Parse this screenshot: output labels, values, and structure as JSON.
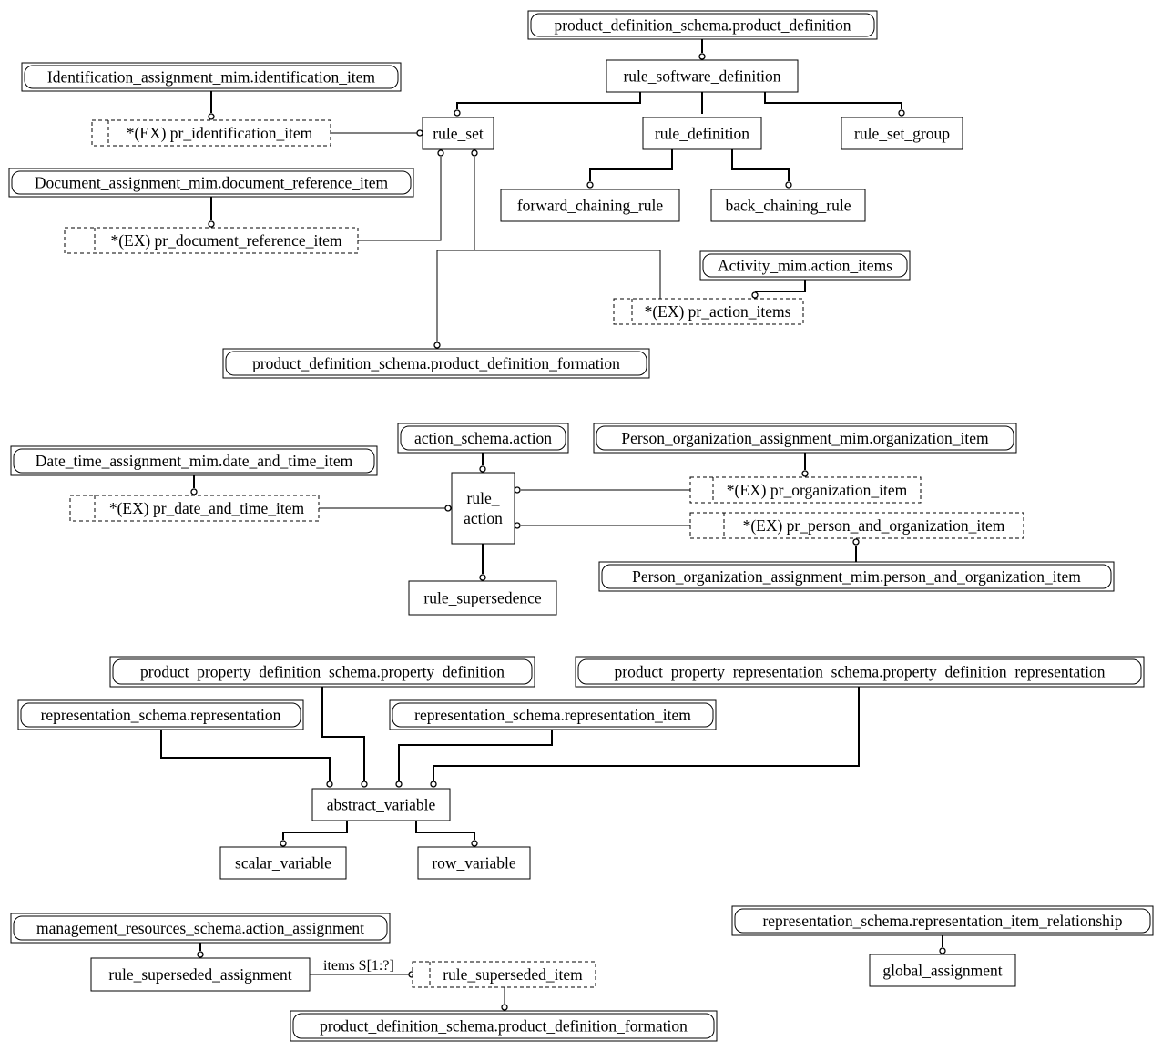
{
  "nodes": [
    {
      "id": "pds_pd",
      "kind": "ref",
      "label": "product_definition_schema.product_definition"
    },
    {
      "id": "rsd",
      "kind": "entity",
      "label": "rule_software_definition"
    },
    {
      "id": "ida",
      "kind": "ref",
      "label": "Identification_assignment_mim.identification_item"
    },
    {
      "id": "pr_id",
      "kind": "select",
      "label": "*(EX) pr_identification_item"
    },
    {
      "id": "rule_set",
      "kind": "entity",
      "label": "rule_set"
    },
    {
      "id": "rule_def",
      "kind": "entity",
      "label": "rule_definition"
    },
    {
      "id": "rsg",
      "kind": "entity",
      "label": "rule_set_group"
    },
    {
      "id": "dam",
      "kind": "ref",
      "label": "Document_assignment_mim.document_reference_item"
    },
    {
      "id": "pr_doc",
      "kind": "select",
      "label": "*(EX) pr_document_reference_item"
    },
    {
      "id": "fcr",
      "kind": "entity",
      "label": "forward_chaining_rule"
    },
    {
      "id": "bcr",
      "kind": "entity",
      "label": "back_chaining_rule"
    },
    {
      "id": "act_mim",
      "kind": "ref",
      "label": "Activity_mim.action_items"
    },
    {
      "id": "pr_action",
      "kind": "select",
      "label": "*(EX) pr_action_items"
    },
    {
      "id": "pdf",
      "kind": "ref",
      "label": "product_definition_schema.product_definition_formation"
    },
    {
      "id": "action",
      "kind": "ref",
      "label": "action_schema.action"
    },
    {
      "id": "poa_org",
      "kind": "ref",
      "label": "Person_organization_assignment_mim.organization_item"
    },
    {
      "id": "dta",
      "kind": "ref",
      "label": "Date_time_assignment_mim.date_and_time_item"
    },
    {
      "id": "rule_action",
      "kind": "entity",
      "label": "rule_",
      "label2": "action"
    },
    {
      "id": "pr_org",
      "kind": "select",
      "label": "*(EX) pr_organization_item"
    },
    {
      "id": "pr_dt",
      "kind": "select",
      "label": "*(EX) pr_date_and_time_item"
    },
    {
      "id": "pr_pao",
      "kind": "select",
      "label": "*(EX) pr_person_and_organization_item"
    },
    {
      "id": "rsup",
      "kind": "entity",
      "label": "rule_supersedence"
    },
    {
      "id": "poa_pao",
      "kind": "ref",
      "label": "Person_organization_assignment_mim.person_and_organization_item"
    },
    {
      "id": "ppd",
      "kind": "ref",
      "label": "product_property_definition_schema.property_definition"
    },
    {
      "id": "pprs",
      "kind": "ref",
      "label": "product_property_representation_schema.property_definition_representation"
    },
    {
      "id": "rs_rep",
      "kind": "ref",
      "label": "representation_schema.representation"
    },
    {
      "id": "rs_item",
      "kind": "ref",
      "label": "representation_schema.representation_item"
    },
    {
      "id": "av",
      "kind": "entity",
      "label": "abstract_variable"
    },
    {
      "id": "sv",
      "kind": "entity",
      "label": "scalar_variable"
    },
    {
      "id": "rv",
      "kind": "entity",
      "label": "row_variable"
    },
    {
      "id": "mra",
      "kind": "ref",
      "label": "management_resources_schema.action_assignment"
    },
    {
      "id": "rsa",
      "kind": "entity",
      "label": "rule_superseded_assignment"
    },
    {
      "id": "rsi",
      "kind": "select",
      "label": "rule_superseded_item"
    },
    {
      "id": "pdf2",
      "kind": "ref",
      "label": "product_definition_schema.product_definition_formation"
    },
    {
      "id": "rsir",
      "kind": "ref",
      "label": "representation_schema.representation_item_relationship"
    },
    {
      "id": "ga",
      "kind": "entity",
      "label": "global_assignment"
    }
  ],
  "relationship_labels": [
    {
      "id": "items",
      "label": "items S[1:?]"
    }
  ]
}
